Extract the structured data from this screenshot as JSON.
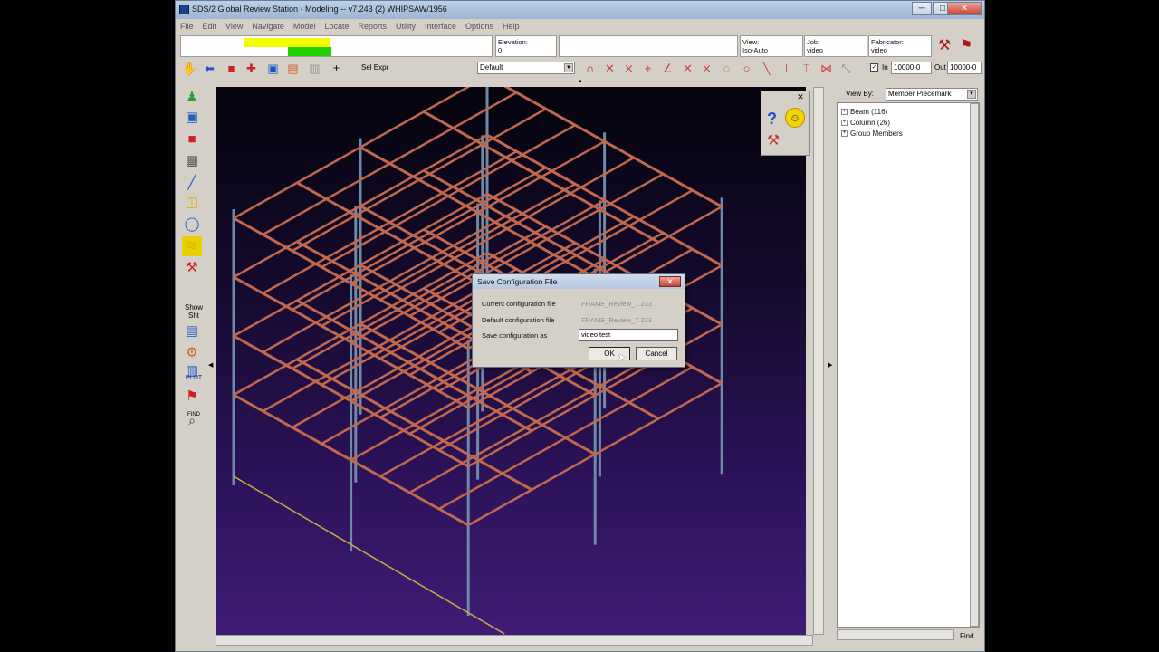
{
  "window": {
    "title": "SDS/2 Global Review Station - Modeling  --  v7.243  (2) WHIPSAW/1956",
    "minimize": "─",
    "maximize": "□",
    "close": "✕"
  },
  "menu": [
    "File",
    "Edit",
    "View",
    "Navigate",
    "Model",
    "Locate",
    "Reports",
    "Utility",
    "Interface",
    "Options",
    "Help"
  ],
  "info": {
    "elevation_label": "Elevation:",
    "elevation_value": "0",
    "view_label": "View:",
    "view_value": "Iso-Auto",
    "job_label": "Job:",
    "job_value": "video",
    "fabricator_label": "Fabricator:",
    "fabricator_value": "video"
  },
  "toolbar": {
    "sel_expr": "Sel Expr",
    "filter_value": "Default",
    "in_label": "In",
    "in_value": "10000-0",
    "out_label": "Out",
    "out_value": "10000-0"
  },
  "left_tools": {
    "show_label": "Show",
    "sht_label": "Sht",
    "plot_label": "PLOT",
    "find_label": "FIND"
  },
  "right_panel": {
    "view_by_label": "View By:",
    "view_by_value": "Member Piecemark",
    "items": [
      "Beam (116)",
      "Column (26)",
      "Group Members"
    ],
    "find_button": "Find"
  },
  "dialog": {
    "title": "Save Configuration File",
    "close": "✕",
    "current_label": "Current configuration file",
    "current_value": "FRAME_Review_7.233",
    "default_label": "Default configuration file",
    "default_value": "FRAME_Review_7.233",
    "save_label": "Save configuration as",
    "save_value": "video test",
    "ok": "OK",
    "cancel": "Cancel"
  },
  "colors": {
    "beam": "#c2684f",
    "column": "#6f8aa6",
    "viewport_top": "#05040e",
    "viewport_bottom": "#3f1c76"
  }
}
